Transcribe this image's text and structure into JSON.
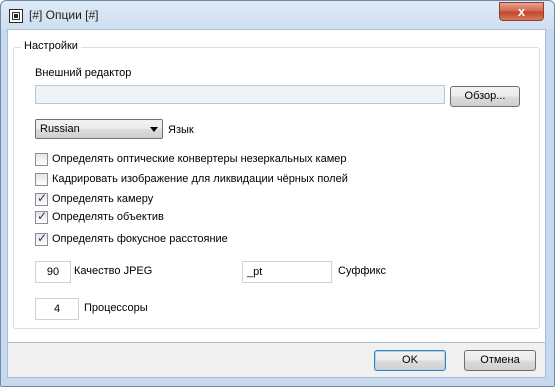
{
  "window": {
    "title": "[#] Опции [#]",
    "close_label": "x"
  },
  "group": {
    "label": "Настройки"
  },
  "editor": {
    "label": "Внешний редактор",
    "value": "",
    "browse_label": "Обзор..."
  },
  "language": {
    "value": "Russian",
    "label": "Язык"
  },
  "checkboxes": [
    {
      "label": "Определять оптические конвертеры незеркальных камер",
      "checked": false
    },
    {
      "label": "Кадрировать изображение для ликвидации чёрных полей",
      "checked": false
    },
    {
      "label": "Определять камеру",
      "checked": true
    },
    {
      "label": "Определять объектив",
      "checked": true
    },
    {
      "label": "Определять фокусное расстояние",
      "checked": true
    }
  ],
  "jpeg": {
    "value": "90",
    "label": "Качество JPEG"
  },
  "suffix": {
    "value": "_pt",
    "label": "Суффикс"
  },
  "processors": {
    "value": "4",
    "label": "Процессоры"
  },
  "buttons": {
    "ok": "OK",
    "cancel": "Отмена"
  }
}
